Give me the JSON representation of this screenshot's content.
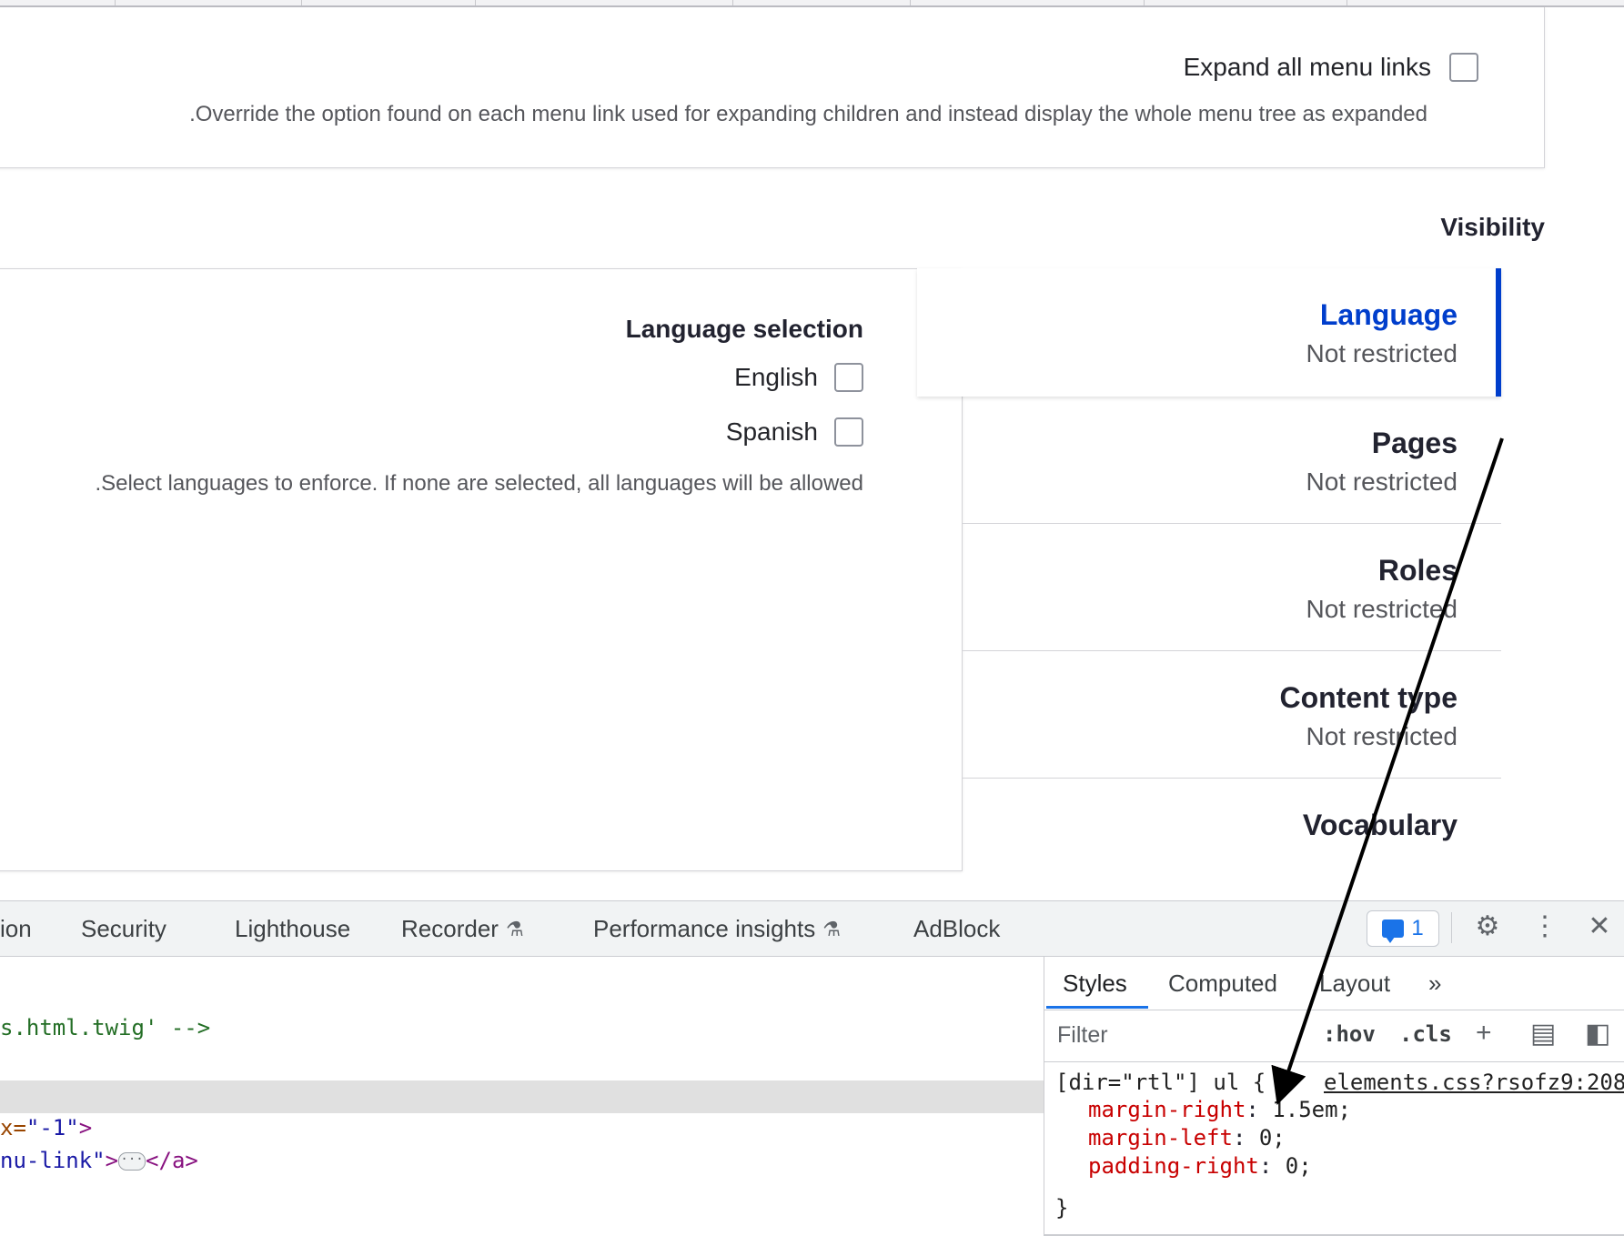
{
  "menu_settings": {
    "expand_label": "Expand all menu links",
    "expand_description": ".Override the option found on each menu link used for expanding children and instead display the whole menu tree as expanded"
  },
  "visibility": {
    "title": "Visibility",
    "language_pane": {
      "title": "Language selection",
      "options": [
        {
          "label": "English",
          "checked": false
        },
        {
          "label": "Spanish",
          "checked": false
        }
      ],
      "description": ".Select languages to enforce. If none are selected, all languages will be allowed"
    },
    "tabs": [
      {
        "name": "Language",
        "summary": "Not restricted",
        "selected": true
      },
      {
        "name": "Pages",
        "summary": "Not restricted",
        "selected": false
      },
      {
        "name": "Roles",
        "summary": "Not restricted",
        "selected": false
      },
      {
        "name": "Content type",
        "summary": "Not restricted",
        "selected": false
      },
      {
        "name": "Vocabulary",
        "summary": "",
        "selected": false
      }
    ]
  },
  "devtools": {
    "tabs": [
      {
        "label": "ion",
        "experimental": false
      },
      {
        "label": "Security",
        "experimental": false
      },
      {
        "label": "Lighthouse",
        "experimental": false
      },
      {
        "label": "Recorder",
        "experimental": true
      },
      {
        "label": "Performance insights",
        "experimental": true
      },
      {
        "label": "AdBlock",
        "experimental": false
      }
    ],
    "issues_count": "1",
    "elements_lines": {
      "line1": "s.html.twig' -->",
      "line2_attr": "x=",
      "line2_val": "\"-1\"",
      "line2_end": ">",
      "line3_val": "nu-link\"",
      "line3_end": ">",
      "line3_close": "</a>"
    },
    "styles_panel": {
      "tabs": [
        "Styles",
        "Computed",
        "Layout"
      ],
      "more": "»",
      "filter_placeholder": "Filter",
      "hov": ":hov",
      "cls": ".cls",
      "rule": {
        "selector": "[dir=\"rtl\"] ul {",
        "source": "elements.css?rsofz9:208",
        "properties": [
          {
            "name": "margin-right",
            "value": "1.5em;"
          },
          {
            "name": "margin-left",
            "value": "0;"
          },
          {
            "name": "padding-right",
            "value": "0;"
          }
        ],
        "close": "}"
      }
    },
    "colors": {
      "accent": "#1a73e8",
      "tab_selected": "#003ecc"
    },
    "icons": [
      "gear-icon",
      "kebab-menu-icon",
      "close-icon",
      "issues-icon",
      "add-rule-icon",
      "paint-icon",
      "sidebar-toggle-icon"
    ]
  }
}
